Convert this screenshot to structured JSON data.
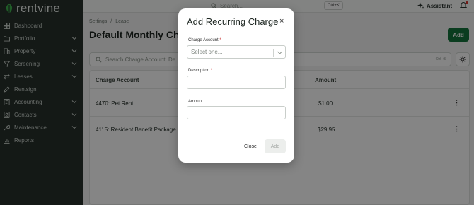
{
  "app": {
    "logo_text": "rentvine"
  },
  "sidebar": {
    "items": [
      {
        "label": "Dashboard",
        "icon": "grid-icon",
        "has_chevron": false
      },
      {
        "label": "Portfolio",
        "icon": "folder-icon",
        "has_chevron": true
      },
      {
        "label": "Property",
        "icon": "building-icon",
        "has_chevron": true
      },
      {
        "label": "Screening",
        "icon": "funnel-icon",
        "has_chevron": true
      },
      {
        "label": "Leases",
        "icon": "swap-icon",
        "has_chevron": true
      },
      {
        "label": "Rentsign",
        "icon": "pen-icon",
        "has_chevron": false
      },
      {
        "label": "Accounting",
        "icon": "ledger-icon",
        "has_chevron": true
      },
      {
        "label": "Contacts",
        "icon": "contacts-icon",
        "has_chevron": true
      },
      {
        "label": "Maintenance",
        "icon": "wrench-icon",
        "has_chevron": true
      },
      {
        "label": "Reports",
        "icon": "chart-icon",
        "has_chevron": false
      }
    ]
  },
  "topbar": {
    "search_placeholder": "Search...",
    "shortcut": "Ctrl+K",
    "assistant_label": "Assistant"
  },
  "breadcrumb": {
    "items": [
      "Settings",
      "Lease"
    ],
    "separator": "/"
  },
  "page": {
    "title": "Default Monthly Cha",
    "add_label": "Add"
  },
  "list_search": {
    "placeholder": "Search Charge Account, De",
    "shortcut": "Ctrl +S"
  },
  "table": {
    "headers": {
      "account": "Charge Account",
      "amount": "Amount"
    },
    "rows": [
      {
        "account": "4470: Pet Rent",
        "amount": "$1.00"
      },
      {
        "account": "4115: Resident Benefit Package",
        "amount": "$29.95"
      }
    ]
  },
  "modal": {
    "title": "Add Recurring Charge",
    "close_icon": "×",
    "charge_account": {
      "label": "Charge Account",
      "required_mark": "*",
      "placeholder": "Select one..."
    },
    "description": {
      "label": "Description",
      "required_mark": "*",
      "value": ""
    },
    "amount": {
      "label": "Amount",
      "value": ""
    },
    "close_label": "Close",
    "add_label": "Add"
  },
  "colors": {
    "sidebar_bg": "#27302b",
    "brand_green": "#15743c",
    "logo_green": "#3fb24e"
  }
}
